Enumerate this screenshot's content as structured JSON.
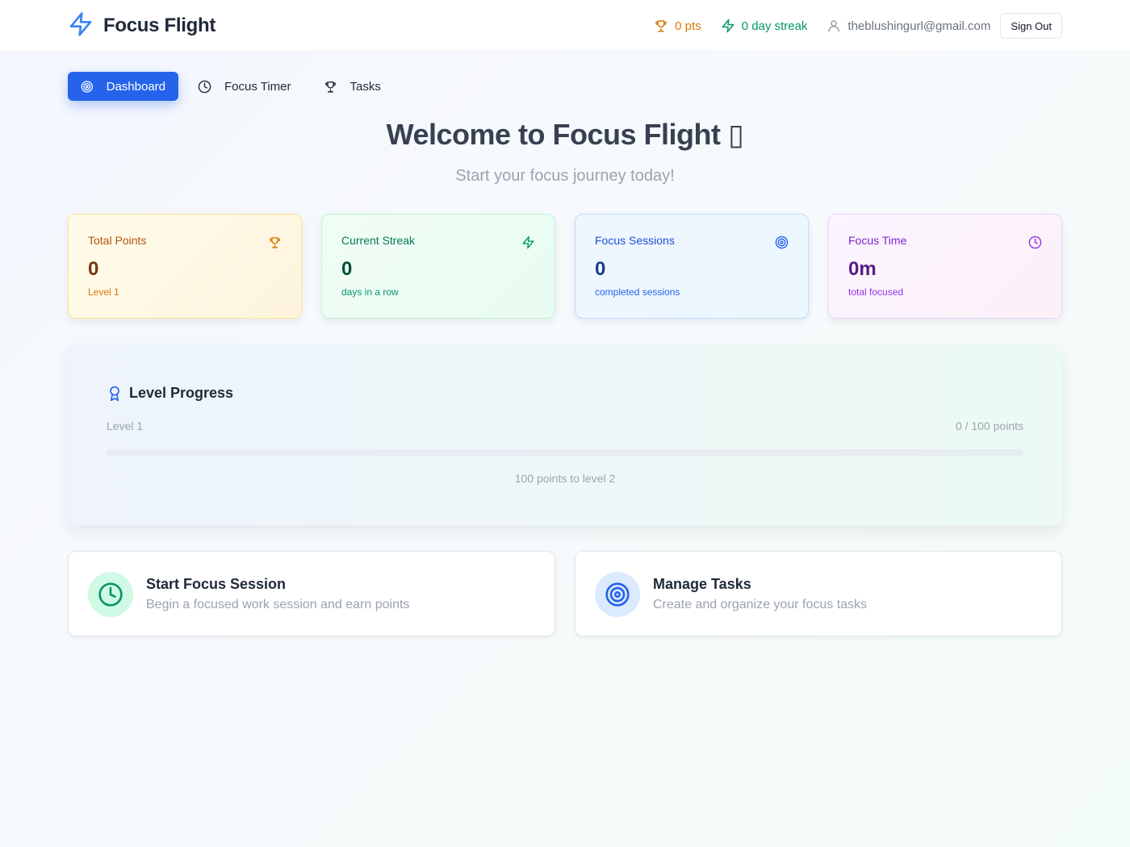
{
  "header": {
    "brand": "Focus Flight",
    "points": "0 pts",
    "streak": "0 day streak",
    "user_email": "theblushingurl@gmail.com",
    "sign_out": "Sign Out"
  },
  "nav": {
    "dashboard": "Dashboard",
    "focus_timer": "Focus Timer",
    "tasks": "Tasks"
  },
  "welcome": {
    "title": "Welcome to Focus Flight ▯",
    "subtitle": "Start your focus journey today!"
  },
  "stats": [
    {
      "label": "Total Points",
      "value": "0",
      "sub": "Level 1",
      "icon": "trophy-icon"
    },
    {
      "label": "Current Streak",
      "value": "0",
      "sub": "days in a row",
      "icon": "zap-icon"
    },
    {
      "label": "Focus Sessions",
      "value": "0",
      "sub": "completed sessions",
      "icon": "target-icon"
    },
    {
      "label": "Focus Time",
      "value": "0m",
      "sub": "total focused",
      "icon": "clock-icon"
    }
  ],
  "level_progress": {
    "title": "Level Progress",
    "level": "Level 1",
    "points": "0 / 100 points",
    "progress_fraction": 0,
    "next": "100 points to level 2"
  },
  "actions": [
    {
      "title": "Start Focus Session",
      "description": "Begin a focused work session and earn points",
      "icon": "clock-icon"
    },
    {
      "title": "Manage Tasks",
      "description": "Create and organize your focus tasks",
      "icon": "target-icon"
    }
  ],
  "colors": {
    "primary": "#2563eb",
    "points": "#d97706",
    "streak": "#059669"
  }
}
